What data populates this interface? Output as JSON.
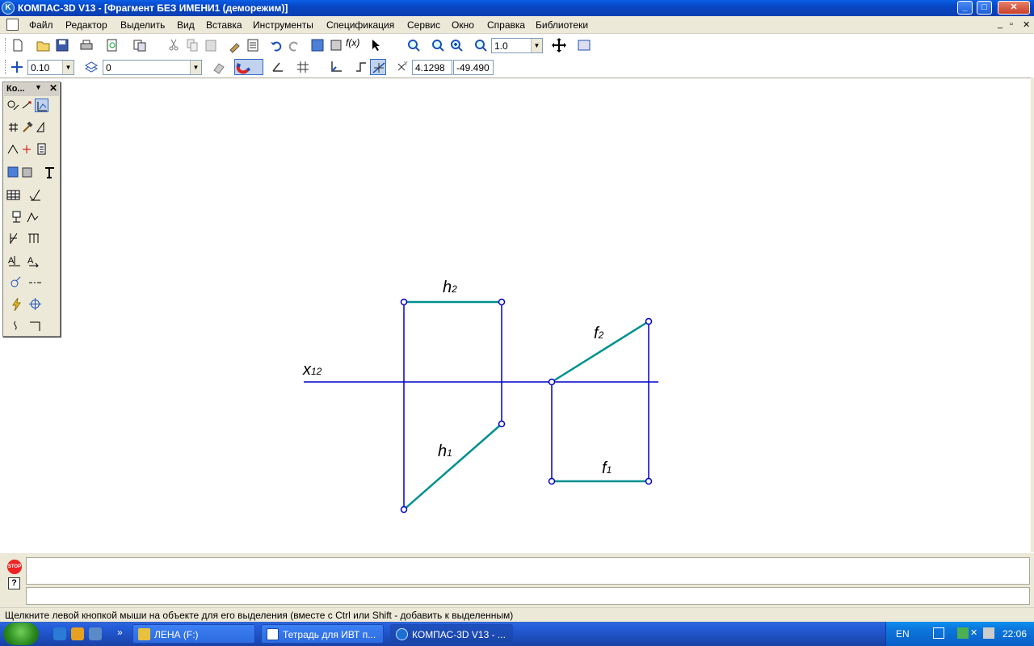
{
  "window": {
    "title": "КОМПАС-3D V13 - [Фрагмент БЕЗ ИМЕНИ1 (деморежим)]",
    "app_icon_letter": "K",
    "min_glyph": "_",
    "max_glyph": "□",
    "close_glyph": "✕"
  },
  "menu": {
    "items": [
      "Файл",
      "Редактор",
      "Выделить",
      "Вид",
      "Вставка",
      "Инструменты",
      "Спецификация",
      "Сервис",
      "Окно",
      "Справка",
      "Библиотеки"
    ],
    "mdi_min": "_",
    "mdi_restore": "▫",
    "mdi_close": "✕"
  },
  "toolbar_standard": {
    "zoom_value": "1.0",
    "fx_label": "f(x)"
  },
  "toolbar_current_state": {
    "step_value": "0.10",
    "layer_value": "0",
    "coord_x": "4.1298",
    "coord_y": "-49.490"
  },
  "compact_panel": {
    "title": "Ко...",
    "dropdown_glyph": "▼",
    "close_glyph": "✕"
  },
  "drawing": {
    "labels": {
      "axis": {
        "main": "x",
        "sub": "12"
      },
      "h2": {
        "main": "h",
        "sub": "2"
      },
      "h1": {
        "main": "h",
        "sub": "1"
      },
      "f2": {
        "main": "f",
        "sub": "2"
      },
      "f1": {
        "main": "f",
        "sub": "1"
      }
    },
    "colors": {
      "construction_line": "#0000cc",
      "object_line": "#009090",
      "point": "#0000cc"
    }
  },
  "bottom_panel": {
    "stop_label": "STOP",
    "help_label": "?"
  },
  "status": {
    "text": "Щелкните левой кнопкой мыши на объекте для его выделения (вместе с Ctrl или Shift - добавить к выделенным)"
  },
  "taskbar": {
    "overflow": "»",
    "tasks": [
      {
        "label": "ЛЕНА (F:)",
        "active": false
      },
      {
        "label": "Тетрадь для ИВТ п...",
        "active": false
      },
      {
        "label": "КОМПАС-3D V13 - ...",
        "active": true
      }
    ],
    "language": "EN",
    "clock": "22:06",
    "colors": {
      "start": "#2b8a1e",
      "tray": "#0b77dd"
    }
  }
}
